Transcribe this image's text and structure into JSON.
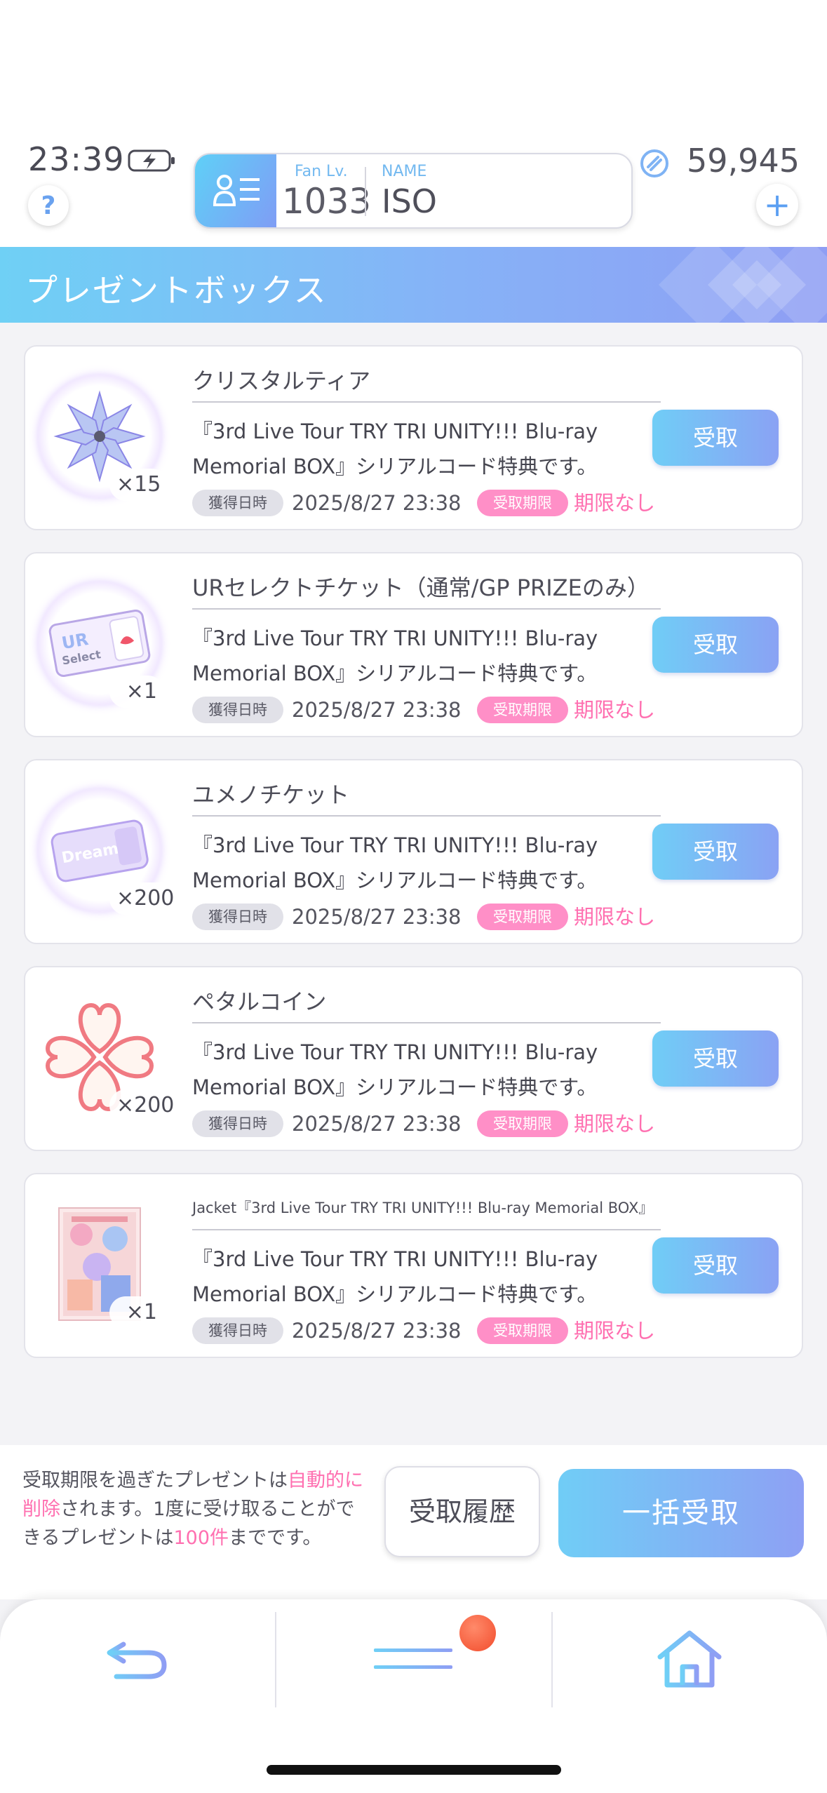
{
  "status_bar": {
    "time": "23:39"
  },
  "header": {
    "fan_level_label": "Fan Lv.",
    "fan_level_value": "1033",
    "name_label": "NAME",
    "name_value": "ISO",
    "currency_value": "59,945",
    "help_label": "?",
    "add_label": "+"
  },
  "title": "プレゼントボックス",
  "presents": [
    {
      "name": "クリスタルティア",
      "count": "×15",
      "description": "『3rd Live Tour TRY TRI UNITY!!! Blu-ray Memorial BOX』シリアルコード特典です。",
      "date_label": "獲得日時",
      "date": "2025/8/27 23:38",
      "limit_label": "受取期限",
      "limit": "期限なし",
      "button": "受取",
      "icon": "crystal-icon"
    },
    {
      "name": "URセレクトチケット（通常/GP PRIZEのみ）",
      "count": "×1",
      "description": "『3rd Live Tour TRY TRI UNITY!!! Blu-ray Memorial BOX』シリアルコード特典です。",
      "date_label": "獲得日時",
      "date": "2025/8/27 23:38",
      "limit_label": "受取期限",
      "limit": "期限なし",
      "button": "受取",
      "icon": "ur-select-ticket-icon",
      "icon_text_1": "UR",
      "icon_text_2": "Select"
    },
    {
      "name": "ユメノチケット",
      "count": "×200",
      "description": "『3rd Live Tour TRY TRI UNITY!!! Blu-ray Memorial BOX』シリアルコード特典です。",
      "date_label": "獲得日時",
      "date": "2025/8/27 23:38",
      "limit_label": "受取期限",
      "limit": "期限なし",
      "button": "受取",
      "icon": "dream-ticket-icon",
      "icon_text_1": "Dream"
    },
    {
      "name": "ペタルコイン",
      "count": "×200",
      "description": "『3rd Live Tour TRY TRI UNITY!!! Blu-ray Memorial BOX』シリアルコード特典です。",
      "date_label": "獲得日時",
      "date": "2025/8/27 23:38",
      "limit_label": "受取期限",
      "limit": "期限なし",
      "button": "受取",
      "icon": "petal-coin-icon"
    },
    {
      "name": "Jacket『3rd Live Tour TRY TRI UNITY!!! Blu-ray Memorial BOX』",
      "count": "×1",
      "description": "『3rd Live Tour TRY TRI UNITY!!! Blu-ray Memorial BOX』シリアルコード特典です。",
      "date_label": "獲得日時",
      "date": "2025/8/27 23:38",
      "limit_label": "受取期限",
      "limit": "期限なし",
      "button": "受取",
      "icon": "jacket-image"
    }
  ],
  "notice": {
    "part1": "受取期限を過ぎたプレゼントは",
    "highlight1": "自動的に削除",
    "part2": "されます。1度に受け取ることができるプレゼントは",
    "highlight2": "100件",
    "part3": "までです。"
  },
  "buttons": {
    "history": "受取履歴",
    "bulk": "一括受取"
  },
  "colors": {
    "accent_blue": "#70cdf6",
    "accent_purple": "#8aa2f4",
    "pink": "#ff8fc7",
    "notification": "#f24c2c"
  }
}
